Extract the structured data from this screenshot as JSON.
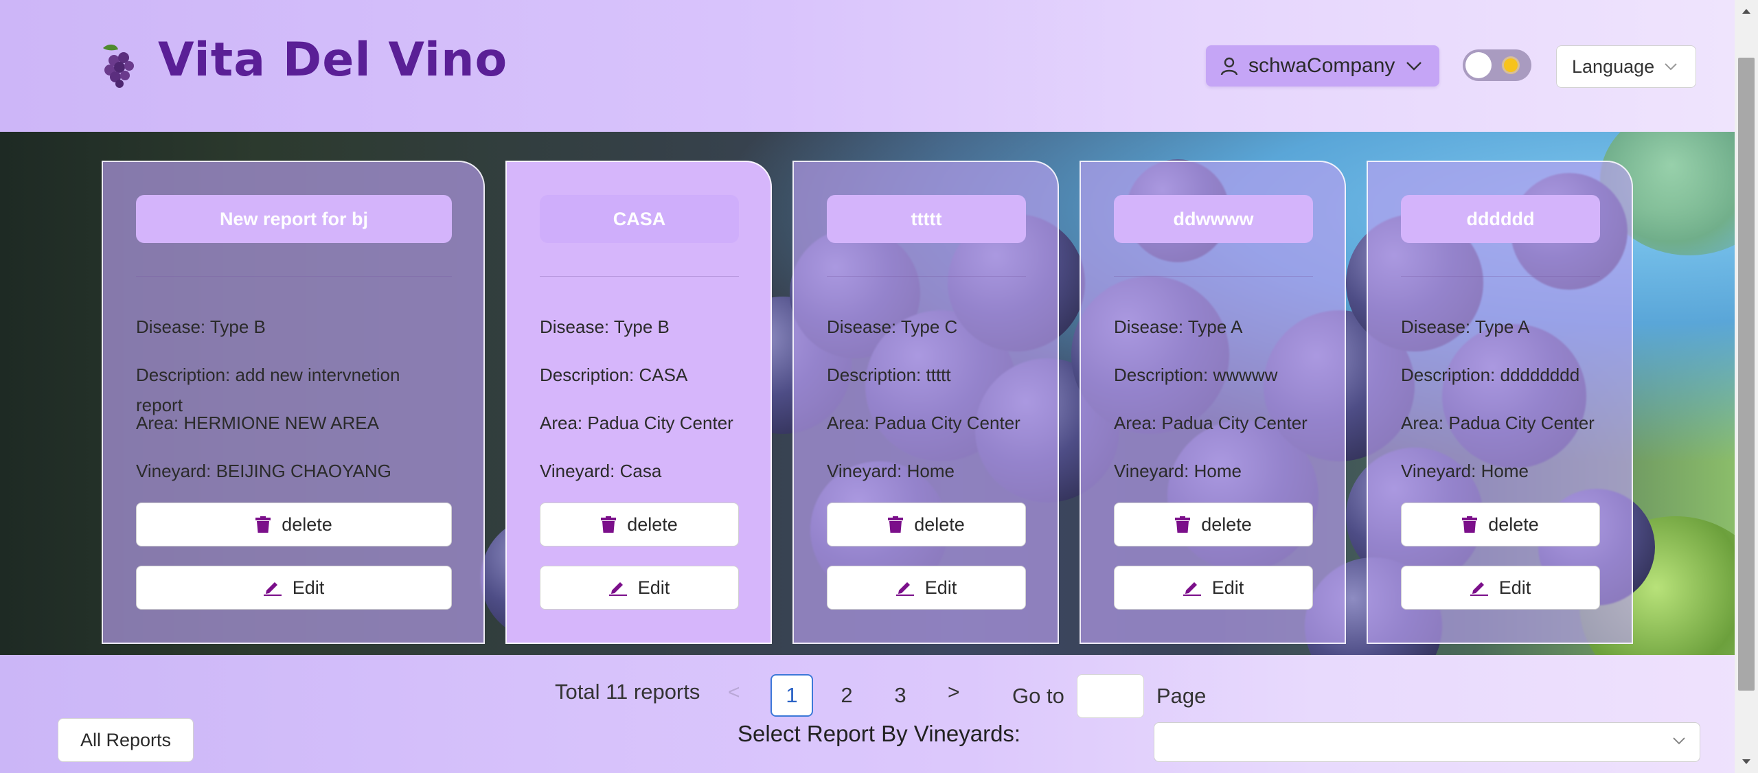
{
  "header": {
    "brand": "Vita Del Vino",
    "user_label": "schwaCompany",
    "language_label": "Language"
  },
  "cards": [
    {
      "title": "New report for bj",
      "disease": "Disease: Type B",
      "description": "Description: add new intervnetion report",
      "area": "Area: HERMIONE NEW AREA",
      "vineyard": "Vineyard: BEIJING CHAOYANG",
      "delete_label": "delete",
      "edit_label": "Edit"
    },
    {
      "title": "CASA",
      "disease": "Disease: Type B",
      "description": "Description: CASA",
      "area": "Area: Padua City Center",
      "vineyard": "Vineyard: Casa",
      "delete_label": "delete",
      "edit_label": "Edit"
    },
    {
      "title": "ttttt",
      "disease": "Disease: Type C",
      "description": "Description: ttttt",
      "area": "Area: Padua City Center",
      "vineyard": "Vineyard: Home",
      "delete_label": "delete",
      "edit_label": "Edit"
    },
    {
      "title": "ddwwww",
      "disease": "Disease: Type A",
      "description": "Description: wwwww",
      "area": "Area: Padua City Center",
      "vineyard": "Vineyard: Home",
      "delete_label": "delete",
      "edit_label": "Edit"
    },
    {
      "title": "dddddd",
      "disease": "Disease: Type A",
      "description": "Description: dddddddd",
      "area": "Area: Padua City Center",
      "vineyard": "Vineyard: Home",
      "delete_label": "delete",
      "edit_label": "Edit"
    }
  ],
  "pagination": {
    "total": "Total 11 reports",
    "prev": "<",
    "pages": [
      "1",
      "2",
      "3"
    ],
    "current": "1",
    "next": ">",
    "goto_label": "Go to",
    "goto_value": "",
    "page_label": "Page"
  },
  "filters": {
    "all_reports_label": "All Reports",
    "select_label": "Select Report By Vineyards:",
    "select_value": ""
  },
  "icons": {
    "logo": "grape-icon",
    "user": "user-icon",
    "delete": "trash-icon",
    "edit": "pencil-icon",
    "chevron": "chevron-down-icon"
  },
  "colors": {
    "brand": "#5a1f96",
    "accent": "#7b0f8a",
    "card_title_bg": "#d4b4fb",
    "page_active": "#3c78d8",
    "toggle_sun": "#f7c31c"
  }
}
